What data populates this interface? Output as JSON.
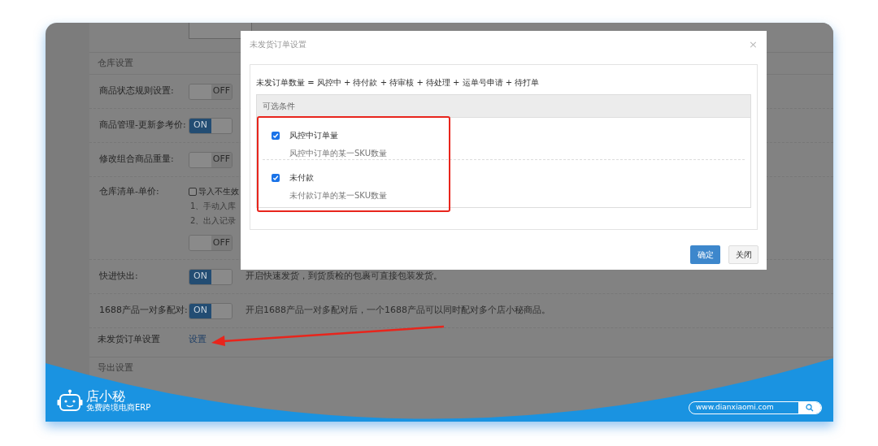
{
  "settings_section": {
    "title": "仓库设置"
  },
  "settings": [
    {
      "kind": "toggle",
      "label": "商品状态规则设置:",
      "on": false,
      "state_text": "OFF"
    },
    {
      "kind": "toggle",
      "label": "商品管理-更新参考价:",
      "on": true,
      "state_text": "ON"
    },
    {
      "kind": "toggle",
      "label": "修改组合商品重量:",
      "on": false,
      "state_text": "OFF"
    },
    {
      "kind": "checkbox_toggle",
      "label": "仓库清单-单价:",
      "checkbox_label": "导入不生效",
      "checked": false,
      "notes": [
        "1、手动入库",
        "2、出入记录"
      ],
      "on": false,
      "state_text": "OFF"
    },
    {
      "kind": "toggle",
      "label": "快进快出:",
      "on": true,
      "state_text": "ON",
      "description": "开启快速发货，到货质检的包裹可直接包装发货。"
    },
    {
      "kind": "toggle",
      "label": "1688产品一对多配对:",
      "on": true,
      "state_text": "ON",
      "description": "开启1688产品一对多配对后，一个1688产品可以同时配对多个店小秘商品。"
    },
    {
      "kind": "link",
      "label": "未发货订单设置",
      "link": "设置"
    }
  ],
  "export_section": {
    "title": "导出设置"
  },
  "dialog": {
    "title": "未发货订单设置",
    "close": "×",
    "formula": "未发订单数量 = 风控中 + 待付款 + 待审核 + 待处理 + 运单号申请 + 待打单",
    "table_header": "可选条件",
    "options": [
      {
        "title": "风控中订单量",
        "description": "风控中订单的某一SKU数量",
        "checked": true
      },
      {
        "title": "未付款",
        "description": "未付款订单的某一SKU数量",
        "checked": true
      }
    ],
    "buttons": [
      {
        "label": "确定",
        "kind": "primary"
      },
      {
        "label": "关闭",
        "kind": "default"
      }
    ]
  },
  "footer": {
    "brand": "店小秘",
    "slogan": "免费跨境电商ERP",
    "url": "www.dianxiaomi.com"
  }
}
